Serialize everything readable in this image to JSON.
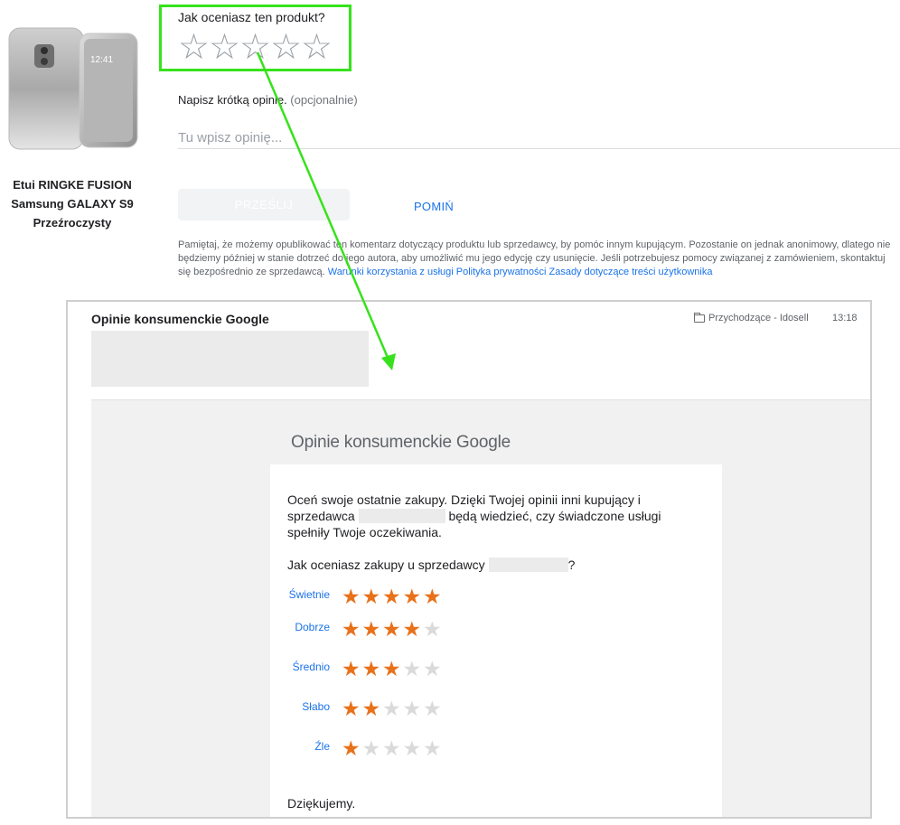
{
  "product": {
    "image_alt": "phone-case",
    "name": "Etui RINGKE FUSION Samsung GALAXY S9 Przeźroczysty"
  },
  "form": {
    "question": "Jak oceniasz ten produkt?",
    "stars": [
      "☆",
      "☆",
      "☆",
      "☆",
      "☆"
    ],
    "review_label": "Napisz krótką opinię.",
    "review_optional": "(opcjonalnie)",
    "review_placeholder": "Tu wpisz opinię...",
    "submit_label": "PRZEŚLIJ",
    "skip_label": "POMIŃ",
    "disclaimer_text": "Pamiętaj, że możemy opublikować ten komentarz dotyczący produktu lub sprzedawcy, by pomóc innym kupującym. Pozostanie on jednak anonimowy, dlatego nie będziemy później w stanie dotrzeć do jego autora, aby umożliwić mu jego edycję czy usunięcie. Jeśli potrzebujesz pomocy związanej z zamówieniem, skontaktuj się bezpośrednio ze sprzedawcą.",
    "links": [
      "Warunki korzystania z usługi",
      "Polityka prywatności",
      "Zasady dotyczące treści użytkownika"
    ]
  },
  "email": {
    "sender": "Opinie konsumenckie Google",
    "folder": "Przychodzące - Idosell",
    "time": "13:18",
    "brand": "Opinie konsumenckie Google",
    "intro_part1": "Oceń swoje ostatnie zakupy. Dzięki Twojej opinii inni kupujący i sprzedawca",
    "intro_part2": "będą wiedzieć, czy świadczone usługi spełniły Twoje oczekiwania.",
    "question_part1": "Jak oceniasz zakupy u sprzedawcy",
    "question_part2": "?",
    "ratings": [
      {
        "label": "Świetnie",
        "stars": 5
      },
      {
        "label": "Dobrze",
        "stars": 4
      },
      {
        "label": "Średnio",
        "stars": 3
      },
      {
        "label": "Słabo",
        "stars": 2
      },
      {
        "label": "Źle",
        "stars": 1
      }
    ],
    "thanks": "Dziękujemy."
  },
  "colors": {
    "highlight": "#37e21c",
    "star_on": "#e8711a",
    "link": "#1a73e8"
  }
}
